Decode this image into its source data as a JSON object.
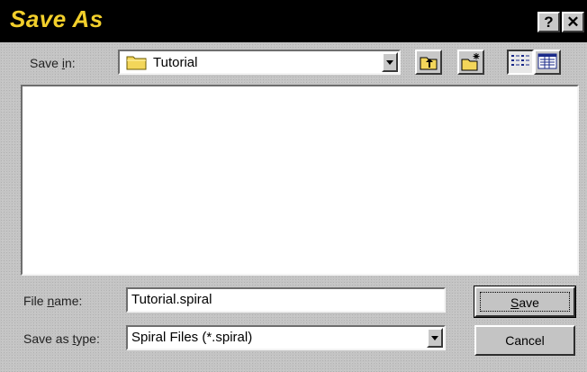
{
  "window": {
    "title": "Save As",
    "help_glyph": "?",
    "close_glyph": "✕"
  },
  "save_in": {
    "label_pre": "Save ",
    "label_key": "i",
    "label_post": "n:",
    "value": "Tutorial",
    "icon": "folder-icon"
  },
  "toolbar": {
    "up_icon": "up-folder-icon",
    "new_icon": "new-folder-icon",
    "list_icon": "list-view-icon",
    "details_icon": "details-view-icon"
  },
  "file_name": {
    "label_pre": "File ",
    "label_key": "n",
    "label_post": "ame:",
    "value": "Tutorial.spiral"
  },
  "save_type": {
    "label_pre": "Save as ",
    "label_key": "t",
    "label_post": "ype:",
    "value": "Spiral Files (*.spiral)"
  },
  "buttons": {
    "save_key": "S",
    "save_rest": "ave",
    "cancel": "Cancel"
  },
  "colors": {
    "title_bg": "#000000",
    "title_text": "#f2cf2b",
    "face": "#c4c4c4"
  }
}
